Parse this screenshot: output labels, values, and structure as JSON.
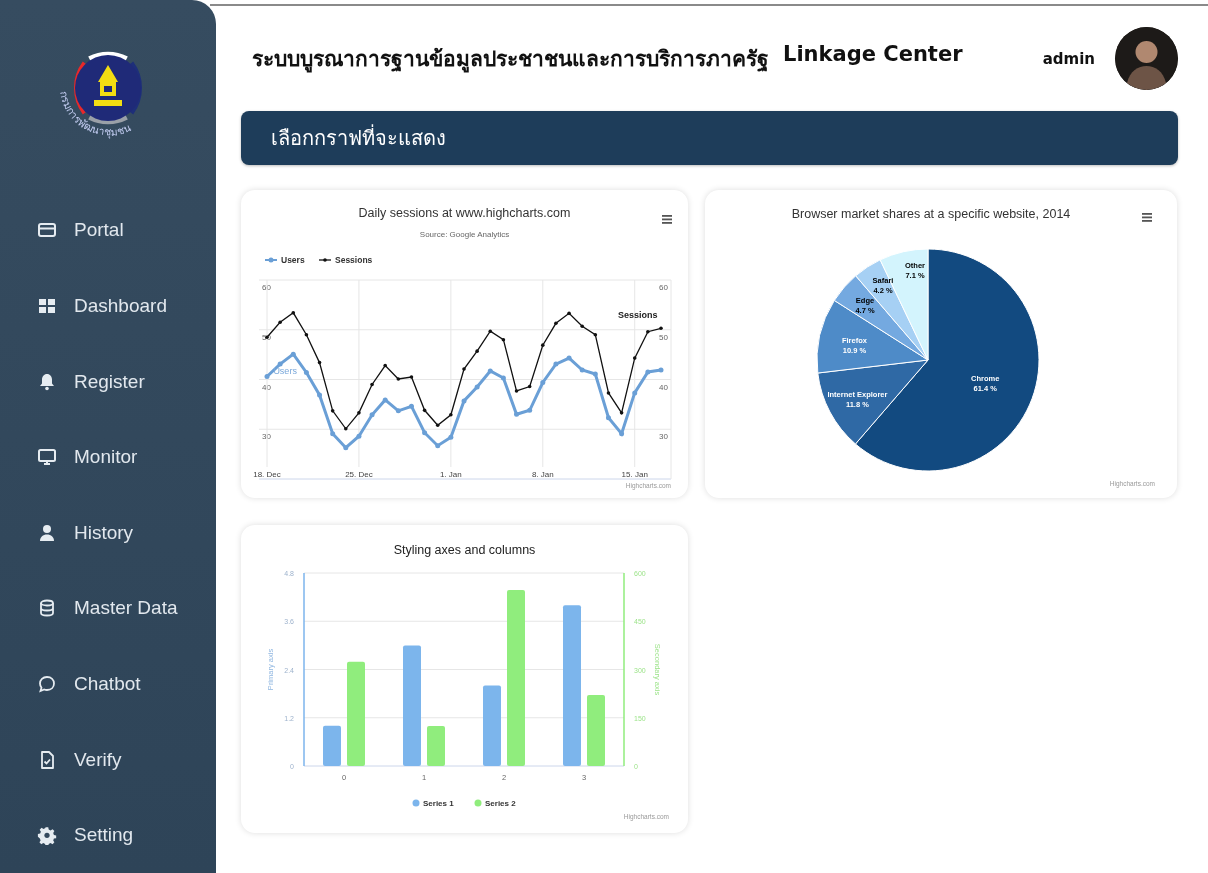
{
  "sidebar": {
    "logo": {
      "caption": "กรมการพัฒนาชุมชน"
    },
    "items": [
      {
        "label": "Portal"
      },
      {
        "label": "Dashboard"
      },
      {
        "label": "Register"
      },
      {
        "label": "Monitor"
      },
      {
        "label": "History"
      },
      {
        "label": "Master Data"
      },
      {
        "label": "Chatbot"
      },
      {
        "label": "Verify"
      },
      {
        "label": "Setting"
      }
    ]
  },
  "header": {
    "title": "ระบบบูรณาการฐานข้อมูลประชาชนและการบริการภาครัฐ",
    "title_suffix": "Linkage Center",
    "user": "admin"
  },
  "banner": {
    "label": "เลือกกราฟที่จะแสดง"
  },
  "cards": [
    {
      "subtitle": "Source: Google Analytics",
      "credit": "Highcharts.com",
      "chart_data": {
        "type": "line",
        "title": "Daily sessions at www.highcharts.com",
        "categories": [
          "18. Dec",
          null,
          null,
          null,
          null,
          null,
          null,
          "25. Dec",
          null,
          null,
          null,
          null,
          null,
          null,
          "1. Jan",
          null,
          null,
          null,
          null,
          null,
          null,
          "8. Jan",
          null,
          null,
          null,
          null,
          null,
          null,
          "15. Jan",
          null,
          null
        ],
        "ylim": [
          20,
          60
        ],
        "yticks": [
          30,
          40,
          50,
          60
        ],
        "y2lim": [
          20,
          60
        ],
        "y2ticks": [
          30,
          40,
          50,
          60
        ],
        "grid": true,
        "legend": true,
        "series": [
          {
            "name": "Users",
            "color": "#6a9fd6",
            "values": [
              40.6,
              43.1,
              45.1,
              41.4,
              36.9,
              29.1,
              26.3,
              28.6,
              32.9,
              35.9,
              33.7,
              34.6,
              29.3,
              26.7,
              28.4,
              35.7,
              38.5,
              41.7,
              40.3,
              33,
              33.8,
              39.4,
              43.1,
              44.3,
              41.9,
              41.1,
              32.3,
              29.1,
              37.3,
              41.5,
              41.9
            ]
          },
          {
            "name": "Sessions",
            "color": "#111111",
            "values": [
              48.5,
              51.5,
              53.4,
              49,
              43.4,
              33.7,
              30.1,
              33.3,
              39,
              42.8,
              40.1,
              40.5,
              33.8,
              30.8,
              32.9,
              42.1,
              45.7,
              49.7,
              48,
              37.7,
              38.6,
              46.9,
              51.3,
              53.3,
              50.7,
              49,
              37.3,
              33.3,
              44.3,
              49.6,
              50.3
            ]
          }
        ],
        "annotations": [
          "Users",
          "Sessions"
        ]
      }
    },
    {
      "credit": "Highcharts.com",
      "chart_data": {
        "type": "pie",
        "title": "Browser market shares at a specific website, 2014",
        "categories": [
          "Chrome",
          "Internet Explorer",
          "Firefox",
          "Edge",
          "Safari",
          "Other"
        ],
        "series": [
          {
            "colors": [
              "#124a80",
              "#2f69a5",
              "#4e8bc8",
              "#74a9e0",
              "#a6d0f4",
              "#d3f4fd"
            ],
            "values": [
              61.4,
              11.8,
              10.9,
              4.7,
              4.2,
              7.1
            ]
          }
        ],
        "value_labels": [
          "61.4 %",
          "11.8 %",
          "10.9 %",
          "4.7 %",
          "4.2 %",
          "7.1 %"
        ]
      }
    },
    {
      "credit": "Highcharts.com",
      "chart_data": {
        "type": "bar",
        "title": "Styling axes and columns",
        "categories": [
          "0",
          "1",
          "2",
          "3"
        ],
        "ylabel": "Primary axis",
        "ylim": [
          0,
          4.8
        ],
        "yticks": [
          0,
          1.2,
          2.4,
          3.6,
          4.8
        ],
        "y2label": "Secondary axis",
        "y2lim": [
          0,
          600
        ],
        "y2ticks": [
          0,
          150,
          300,
          450,
          600
        ],
        "grid": true,
        "legend": true,
        "series": [
          {
            "name": "Series 1",
            "color": "#7cb5ec",
            "values": [
              1,
              3,
              2,
              4
            ]
          },
          {
            "name": "Series 2",
            "color": "#90ed7d",
            "axis": "y2",
            "values": [
              324,
              124,
              547,
              221
            ]
          }
        ]
      }
    }
  ]
}
